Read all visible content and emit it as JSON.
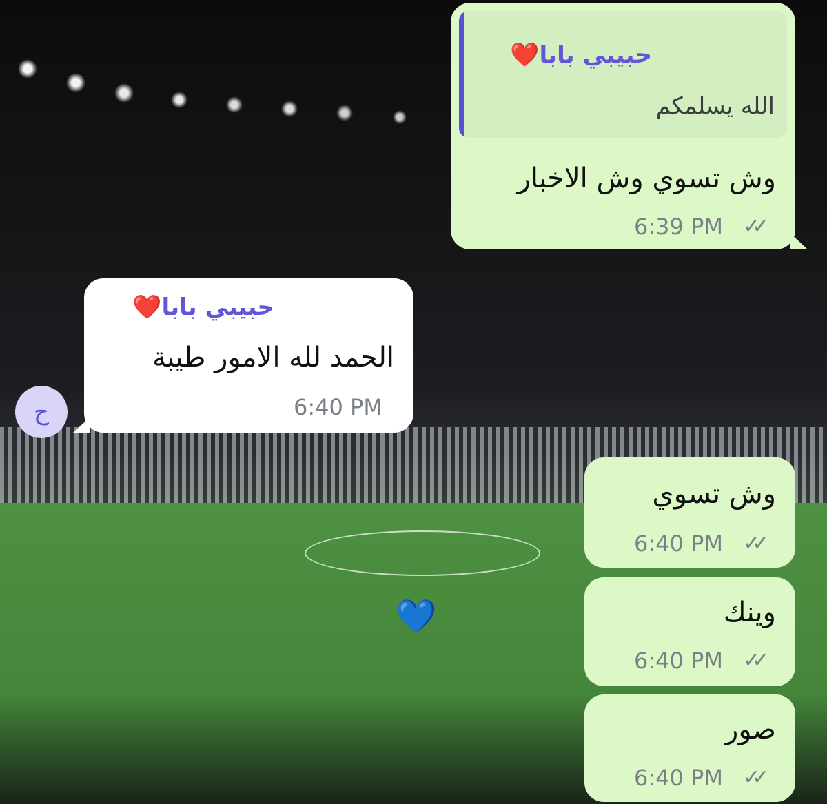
{
  "messages": [
    {
      "direction": "outgoing",
      "reply": {
        "sender": "حبيبي بابا❤️",
        "text": "الله يسلمكم"
      },
      "text": "وش تسوي وش الاخبار",
      "time": "6:39 PM",
      "status_icon": "double-check-icon"
    },
    {
      "direction": "incoming",
      "sender": "حبيبي بابا❤️",
      "text": "الحمد لله الامور طيبة",
      "time": "6:40 PM",
      "avatar_initial": "ح"
    },
    {
      "direction": "outgoing",
      "text": "وش تسوي",
      "time": "6:40 PM",
      "status_icon": "double-check-icon"
    },
    {
      "direction": "outgoing",
      "text": "وينك",
      "time": "6:40 PM",
      "status_icon": "double-check-icon"
    },
    {
      "direction": "outgoing",
      "text": "صور",
      "time": "6:40 PM",
      "status_icon": "double-check-icon"
    }
  ],
  "ticks_glyph": "✓✓",
  "background": {
    "emoji": "💙"
  },
  "colors": {
    "outgoing_bubble": "#dcf8c6",
    "incoming_bubble": "#ffffff",
    "sender_name": "#6355d8",
    "timestamp": "#7b7f86"
  }
}
